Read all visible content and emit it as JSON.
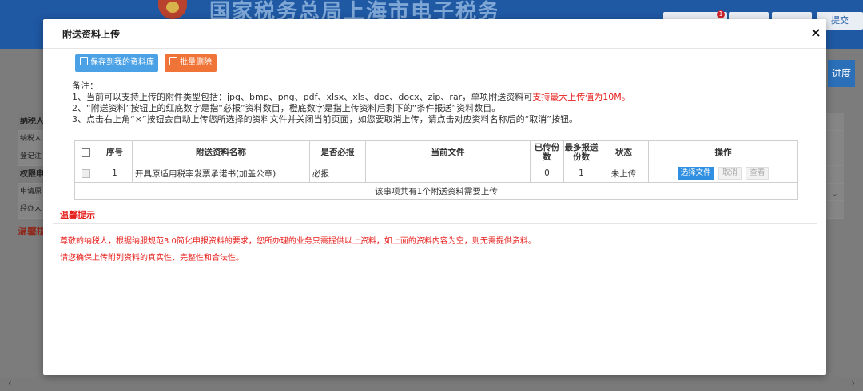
{
  "background": {
    "site_title": "国家税务总局上海市电子税务局",
    "badge_count": "1",
    "submit_label": "提交",
    "progress_label": "进度",
    "rows": [
      "纳税人",
      "纳税人",
      "登记注",
      "权限申",
      "申请原",
      "经办人"
    ],
    "warning": "温馨提示"
  },
  "modal": {
    "title": "附送资料上传",
    "close_icon": "×",
    "toolbar": {
      "save_label": "保存到我的资料库",
      "delete_label": "批量删除"
    },
    "notes": {
      "heading": "备注：",
      "line1_prefix": "1、当前可以支持上传的附件类型包括：jpg、bmp、png、pdf、xlsx、xls、doc、docx、zip、rar，单项附送资料可",
      "line1_highlight": "支持最大上传值为10M。",
      "line2": "2、“附送资料”按钮上的红底数字是指“必报”资料数目，橙底数字是指上传资料后剩下的“条件报送”资料数目。",
      "line3": "3、点击右上角“×”按钮会自动上传您所选择的资料文件并关闭当前页面，如您要取消上传，请点击对应资料名称后的“取消”按钮。"
    },
    "table": {
      "headers": {
        "index": "序号",
        "name": "附送资料名称",
        "required": "是否必报",
        "current_file": "当前文件",
        "uploaded": "已传份数",
        "max": "最多报送份数",
        "status": "状态",
        "actions": "操作"
      },
      "rows": [
        {
          "index": "1",
          "name": "开具原适用税率发票承诺书(加盖公章)",
          "required": "必报",
          "current_file": "",
          "uploaded": "0",
          "max": "1",
          "status": "未上传",
          "choose_label": "选择文件",
          "cancel_label": "取消",
          "view_label": "查看"
        }
      ],
      "summary": "该事项共有1个附送资料需要上传"
    },
    "tips": {
      "title": "温馨提示",
      "line1": "尊敬的纳税人，根据纳服规范3.0简化申报资料的要求，您所办理的业务只需提供以上资料，如上面的资料内容为空，则无需提供资料。",
      "line2": "请您确保上传附列资料的真实性、完整性和合法性。"
    }
  },
  "colors": {
    "header_blue": "#1f58a3",
    "save_button": "#4aa1e5",
    "delete_button": "#f07437",
    "warning_red": "#e5201d",
    "choose_button": "#2f8fe0"
  }
}
